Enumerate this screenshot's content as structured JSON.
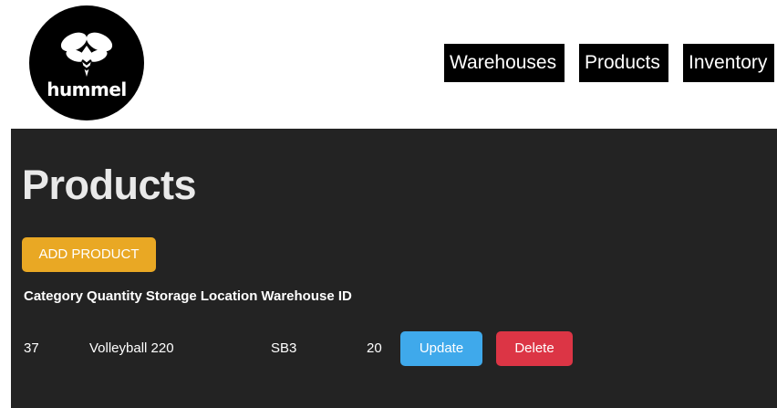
{
  "brand": {
    "name": "hummel",
    "logo_icon": "hummel-bee-logo-icon",
    "background": "#000000"
  },
  "nav": {
    "items": [
      {
        "label": "Warehouses"
      },
      {
        "label": "Products"
      },
      {
        "label": "Inventory"
      }
    ]
  },
  "main": {
    "title": "Products",
    "add_button_label": "ADD PRODUCT",
    "columns": [
      "Category",
      "Quantity",
      "Storage Location",
      "Warehouse ID"
    ],
    "rows": [
      {
        "id": "37",
        "category_quantity": "Volleyball 220",
        "storage_location": "SB3",
        "warehouse_id": "20",
        "update_label": "Update",
        "delete_label": "Delete"
      }
    ]
  },
  "colors": {
    "panel": "#232323",
    "add_button": "#e9a824",
    "update_button": "#3fa9eb",
    "delete_button": "#dc3545"
  }
}
